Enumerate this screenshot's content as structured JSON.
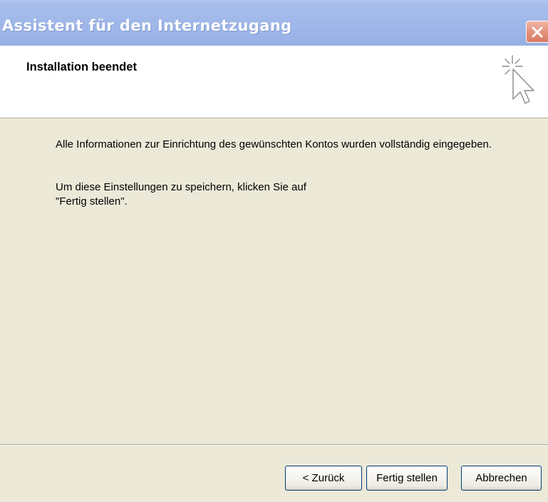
{
  "window": {
    "title": "Assistent für den Internetzugang"
  },
  "header": {
    "title": "Installation beendet"
  },
  "content": {
    "paragraph1": "Alle Informationen zur Einrichtung des gewünschten Kontos wurden vollständig eingegeben.",
    "paragraph2_line1": "Um diese Einstellungen zu speichern, klicken Sie auf",
    "paragraph2_line2": "\"Fertig stellen\"."
  },
  "buttons": {
    "back": "< Zurück",
    "finish": "Fertig stellen",
    "cancel": "Abbrechen"
  },
  "icons": {
    "close": "close-icon",
    "wizard": "wizard-cursor-icon"
  },
  "colors": {
    "titlebar": "#9db5e8",
    "close_button": "#e4937d",
    "dialog_background": "#ece9d8",
    "button_border": "#003c74"
  }
}
